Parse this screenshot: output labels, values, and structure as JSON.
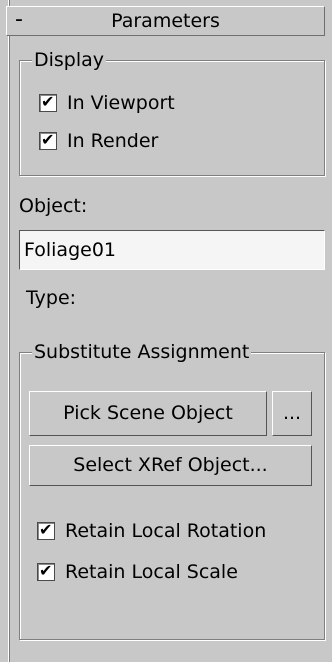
{
  "rollout": {
    "toggle": "-",
    "title": "Parameters"
  },
  "display": {
    "legend": "Display",
    "in_viewport": {
      "label": "In Viewport",
      "checked": true
    },
    "in_render": {
      "label": "In Render",
      "checked": true
    }
  },
  "object": {
    "label": "Object:",
    "value": "Foliage01",
    "type_label": "Type:"
  },
  "substitute": {
    "legend": "Substitute Assignment",
    "pick_button": "Pick Scene Object",
    "more_button": "...",
    "xref_button": "Select XRef Object...",
    "retain_rotation": {
      "label": "Retain Local Rotation",
      "checked": true
    },
    "retain_scale": {
      "label": "Retain Local Scale",
      "checked": true
    }
  },
  "checkmark_glyph": "✔"
}
